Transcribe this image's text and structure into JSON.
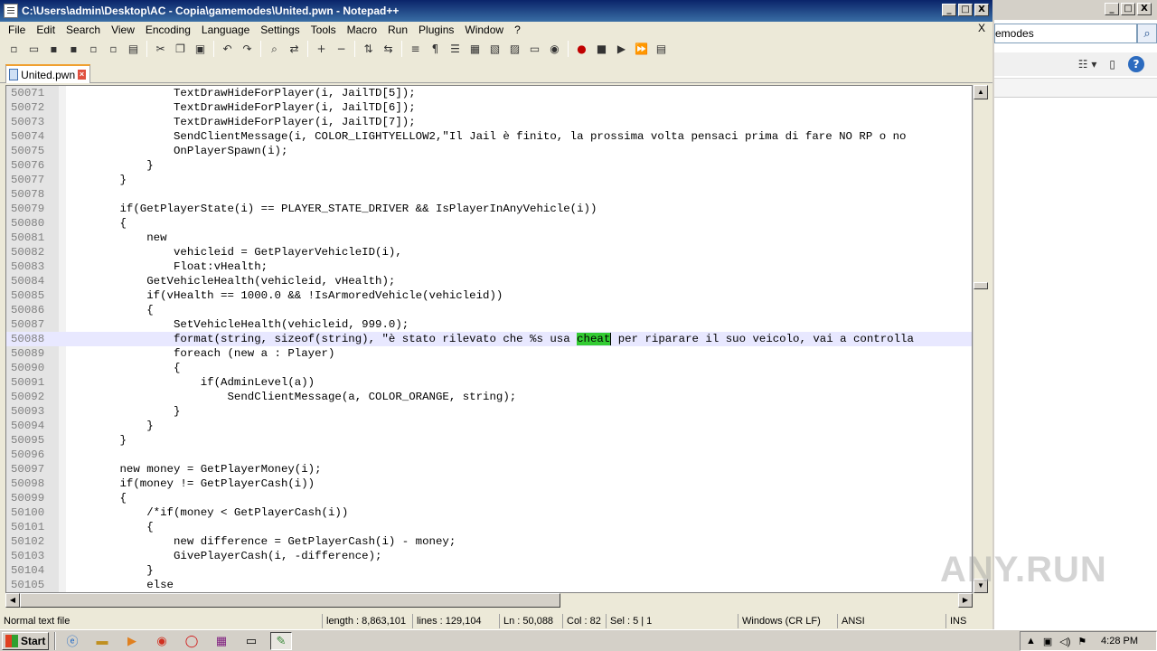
{
  "window": {
    "title": "C:\\Users\\admin\\Desktop\\AC - Copia\\gamemodes\\United.pwn - Notepad++",
    "min": "_",
    "max": "□",
    "close": "X"
  },
  "menu": [
    "File",
    "Edit",
    "Search",
    "View",
    "Encoding",
    "Language",
    "Settings",
    "Tools",
    "Macro",
    "Run",
    "Plugins",
    "Window",
    "?"
  ],
  "menu_close": "X",
  "tab": {
    "label": "United.pwn"
  },
  "editor": {
    "lines": [
      {
        "n": "50071",
        "code": "                TextDrawHideForPlayer(i, JailTD[5]);"
      },
      {
        "n": "50072",
        "code": "                TextDrawHideForPlayer(i, JailTD[6]);"
      },
      {
        "n": "50073",
        "code": "                TextDrawHideForPlayer(i, JailTD[7]);"
      },
      {
        "n": "50074",
        "code": "                SendClientMessage(i, COLOR_LIGHTYELLOW2,\"Il Jail è finito, la prossima volta pensaci prima di fare NO RP o no"
      },
      {
        "n": "50075",
        "code": "                OnPlayerSpawn(i);"
      },
      {
        "n": "50076",
        "code": "            }"
      },
      {
        "n": "50077",
        "code": "        }"
      },
      {
        "n": "50078",
        "code": ""
      },
      {
        "n": "50079",
        "code": "        if(GetPlayerState(i) == PLAYER_STATE_DRIVER && IsPlayerInAnyVehicle(i))"
      },
      {
        "n": "50080",
        "code": "        {"
      },
      {
        "n": "50081",
        "code": "            new"
      },
      {
        "n": "50082",
        "code": "                vehicleid = GetPlayerVehicleID(i),"
      },
      {
        "n": "50083",
        "code": "                Float:vHealth;"
      },
      {
        "n": "50084",
        "code": "            GetVehicleHealth(vehicleid, vHealth);"
      },
      {
        "n": "50085",
        "code": "            if(vHealth == 1000.0 && !IsArmoredVehicle(vehicleid))"
      },
      {
        "n": "50086",
        "code": "            {"
      },
      {
        "n": "50087",
        "code": "                SetVehicleHealth(vehicleid, 999.0);"
      },
      {
        "n": "50088",
        "pre": "                format(string, sizeof(string), \"è stato rilevato che %s usa ",
        "hl": "cheat",
        "post": " per riparare il suo veicolo, vai a controlla"
      },
      {
        "n": "50089",
        "code": "                foreach (new a : Player)"
      },
      {
        "n": "50090",
        "code": "                {"
      },
      {
        "n": "50091",
        "code": "                    if(AdminLevel(a))"
      },
      {
        "n": "50092",
        "code": "                        SendClientMessage(a, COLOR_ORANGE, string);"
      },
      {
        "n": "50093",
        "code": "                }"
      },
      {
        "n": "50094",
        "code": "            }"
      },
      {
        "n": "50095",
        "code": "        }"
      },
      {
        "n": "50096",
        "code": ""
      },
      {
        "n": "50097",
        "code": "        new money = GetPlayerMoney(i);"
      },
      {
        "n": "50098",
        "code": "        if(money != GetPlayerCash(i))"
      },
      {
        "n": "50099",
        "code": "        {"
      },
      {
        "n": "50100",
        "code": "            /*if(money < GetPlayerCash(i))"
      },
      {
        "n": "50101",
        "code": "            {"
      },
      {
        "n": "50102",
        "code": "                new difference = GetPlayerCash(i) - money;"
      },
      {
        "n": "50103",
        "code": "                GivePlayerCash(i, -difference);"
      },
      {
        "n": "50104",
        "code": "            }"
      },
      {
        "n": "50105",
        "code": "            else"
      }
    ]
  },
  "status": {
    "type": "Normal text file",
    "length": "length : 8,863,101",
    "lines": "lines : 129,104",
    "ln": "Ln : 50,088",
    "col": "Col : 82",
    "sel": "Sel : 5 | 1",
    "eol": "Windows (CR LF)",
    "enc": "ANSI",
    "mode": "INS"
  },
  "right_panel": {
    "search_value": "emodes",
    "help": "?"
  },
  "watermark": "ANY.RUN",
  "taskbar": {
    "start": "Start",
    "clock": "4:28 PM"
  }
}
